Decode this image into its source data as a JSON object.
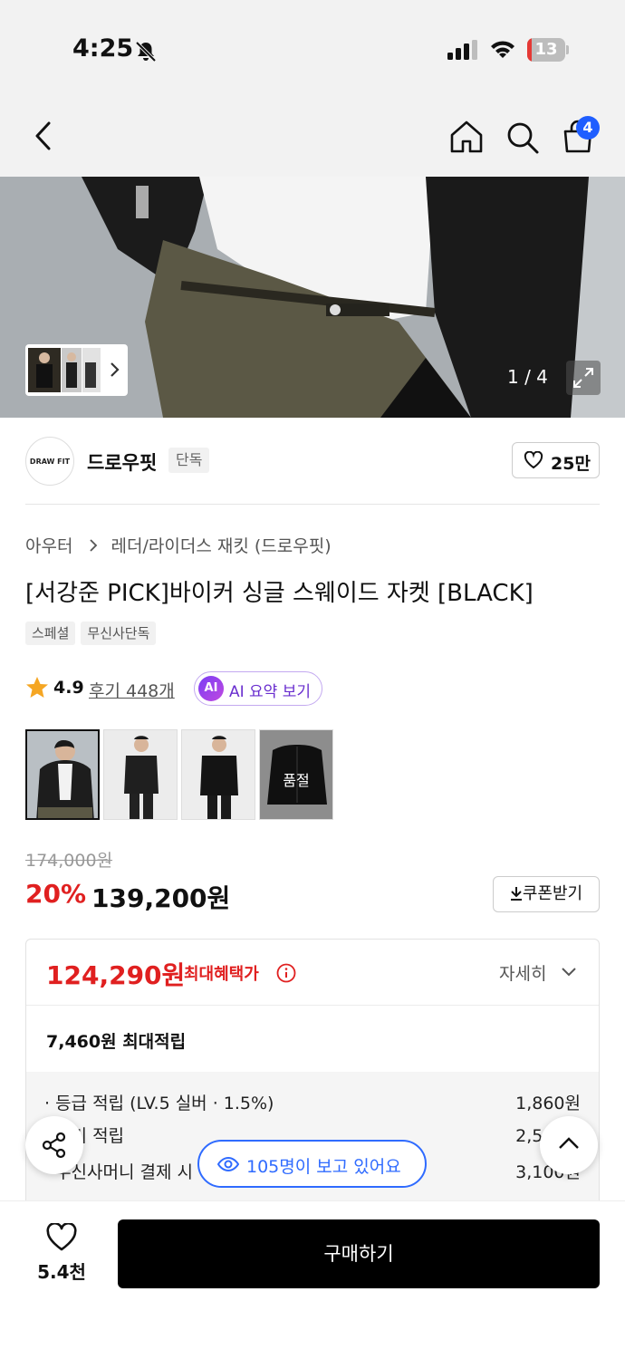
{
  "status_bar": {
    "time": "4:25",
    "battery": "13",
    "battery_level": 0.13
  },
  "header": {
    "cart_count": "4"
  },
  "hero": {
    "counter": "1 / 4"
  },
  "brand": {
    "logo_text": "DRAW FIT",
    "name": "드로우핏",
    "badge": "단독",
    "likes": "25만"
  },
  "breadcrumb": {
    "category": "아우터",
    "subcategory": "레더/라이더스 재킷 (드로우핏)"
  },
  "product": {
    "title": "[서강준 PICK]바이커 싱글 스웨이드 자켓 [BLACK]",
    "tags": [
      "스페셜",
      "무신사단독"
    ],
    "rating": "4.9",
    "reviews": "후기 448개",
    "ai_chip": "AI",
    "ai_summary": "AI 요약 보기",
    "color_options": [
      {
        "name": "option-1",
        "selected": true,
        "soldout": false
      },
      {
        "name": "option-2",
        "selected": false,
        "soldout": false
      },
      {
        "name": "option-3",
        "selected": false,
        "soldout": false
      },
      {
        "name": "option-4",
        "selected": false,
        "soldout": true
      }
    ],
    "soldout_label": "품절",
    "original_price": "174,000원",
    "discount": "20%",
    "price": "139,200원",
    "coupon": "쿠폰받기"
  },
  "benefit": {
    "max_price": "124,290원",
    "max_label": "최대혜택가",
    "detail": "자세히",
    "points": "7,460원 최대적립",
    "rows": [
      {
        "label": "· 등급 적립 (LV.5 실버 · 1.5%)",
        "value": "1,860원"
      },
      {
        "label": "· 후기 적립",
        "value": "2,500원"
      },
      {
        "label": "· 무신사머니 결제 시 적립",
        "value": "3,100원"
      }
    ]
  },
  "floating": {
    "viewers": "105명이 보고 있어요"
  },
  "bottom": {
    "wish_count": "5.4천",
    "buy": "구매하기"
  },
  "colors": {
    "accent_red": "#e02020",
    "accent_blue": "#2f6bff",
    "ai_purple": "#6a2fcf"
  }
}
